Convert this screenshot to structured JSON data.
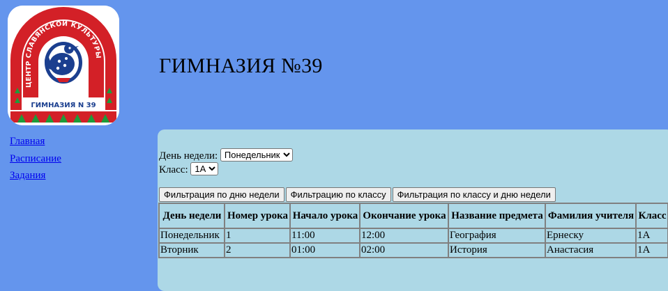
{
  "logo": {
    "arc_text": "ЦЕНТР СЛАВЯНСКОЙ КУЛЬТУРЫ",
    "bottom_text": "ГИМНАЗИЯ N 39"
  },
  "header": {
    "title": "ГИМНАЗИЯ №39"
  },
  "nav": [
    {
      "label": "Главная"
    },
    {
      "label": "Расписание"
    },
    {
      "label": "Задания"
    }
  ],
  "filters": {
    "day_label": "День недели:",
    "day_value": "Понедельник",
    "class_label": "Класс:",
    "class_value": "1А"
  },
  "buttons": {
    "by_day": "Фильтрация по дню недели",
    "by_class": "Фильтрацию по классу",
    "by_class_and_day": "Фильтрация по классу и дню недели"
  },
  "table": {
    "headers": [
      "День недели",
      "Номер урока",
      "Начало урока",
      "Окончание урока",
      "Название предмета",
      "Фамилия учителя",
      "Класс"
    ],
    "rows": [
      [
        "Понедельник",
        "1",
        "11:00",
        "12:00",
        "География",
        "Ернеску",
        "1А"
      ],
      [
        "Вторник",
        "2",
        "01:00",
        "02:00",
        "История",
        "Анастасия",
        "1А"
      ]
    ]
  },
  "colors": {
    "page_background": "#6495ED",
    "panel_background": "#ADD8E6",
    "link": "#0000EE",
    "logo_red": "#D32027",
    "logo_blue": "#1B3F8F",
    "logo_green": "#1E9B3A"
  }
}
